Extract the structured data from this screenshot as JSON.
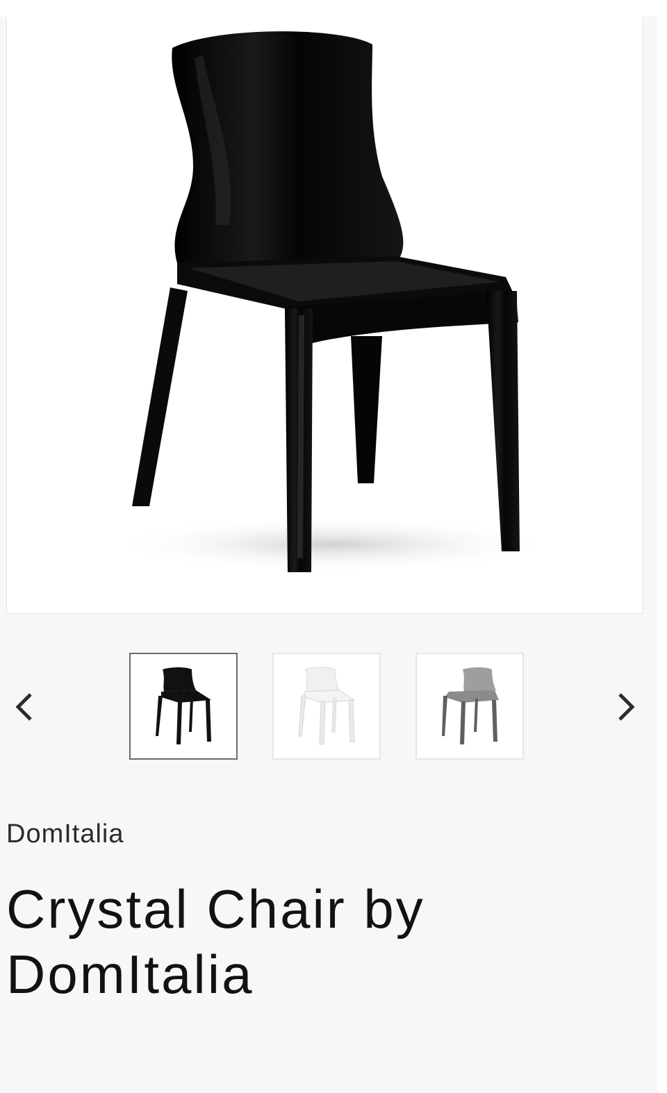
{
  "product": {
    "vendor": "DomItalia",
    "title": "Crystal Chair by DomItalia",
    "main_image": {
      "icon": "black-chair",
      "color": "#0b0b0b"
    }
  },
  "gallery": {
    "prev_icon": "chevron-left-icon",
    "next_icon": "chevron-right-icon",
    "thumbnails": [
      {
        "icon": "black-chair",
        "color": "#111111",
        "selected": true
      },
      {
        "icon": "white-chair",
        "color": "#f0f0f0",
        "selected": false
      },
      {
        "icon": "smoke-chair",
        "color": "#7d7d80",
        "selected": false
      }
    ]
  }
}
